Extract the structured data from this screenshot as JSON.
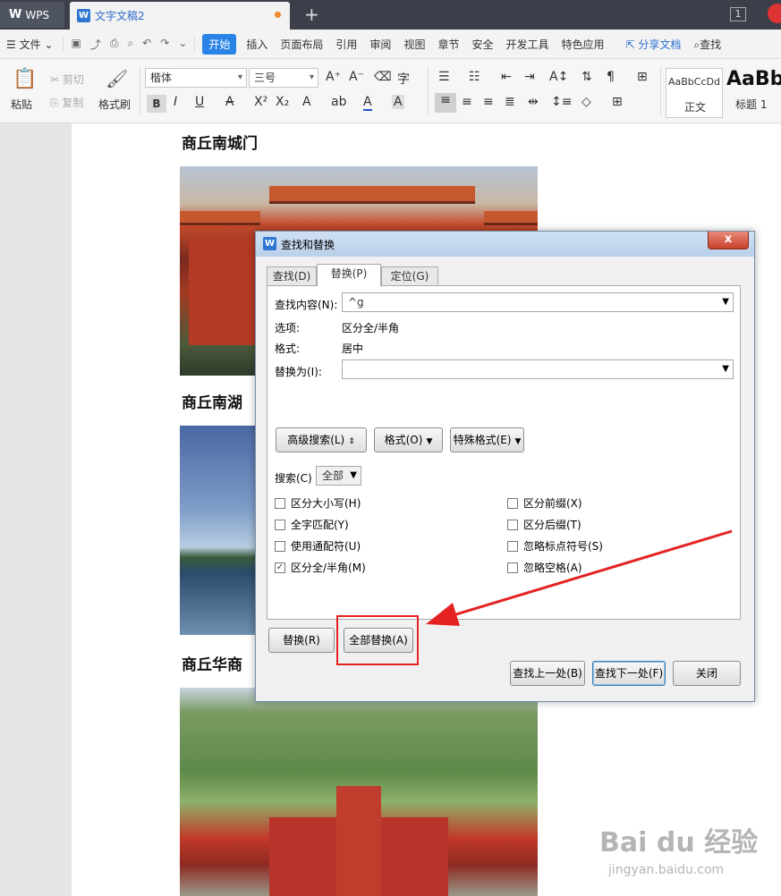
{
  "titlebar": {
    "app_tab": "WPS",
    "doc_tab": "文字文稿2",
    "new_tab": "+",
    "window_count": "1"
  },
  "menubar": {
    "file": "文件",
    "tabs": [
      "开始",
      "插入",
      "页面布局",
      "引用",
      "审阅",
      "视图",
      "章节",
      "安全",
      "开发工具",
      "特色应用"
    ],
    "active_tab": "开始",
    "share": "分享文档",
    "search": "查找"
  },
  "ribbon": {
    "paste": "粘贴",
    "cut": "剪切",
    "copy": "复制",
    "format_painter": "格式刷",
    "font_name": "楷体",
    "font_size": "三号",
    "style_normal_preview": "AaBbCcDd",
    "style_normal": "正文",
    "style_h1_preview": "AaBb",
    "style_h1": "标题 1"
  },
  "document": {
    "heading1": "商丘南城门",
    "heading2": "商丘南湖",
    "heading3": "商丘华商"
  },
  "dialog": {
    "title": "查找和替换",
    "close": "x",
    "tabs": [
      "查找(D)",
      "替换(P)",
      "定位(G)"
    ],
    "active_tab": "替换(P)",
    "find_label": "查找内容(N):",
    "find_value": "^g",
    "options_label": "选项:",
    "options_value": "区分全/半角",
    "format_label": "格式:",
    "format_value": "居中",
    "replace_label": "替换为(I):",
    "replace_value": "",
    "advanced_btn": "高级搜索(L)",
    "format_btn": "格式(O)",
    "special_btn": "特殊格式(E)",
    "search_label": "搜索(C)",
    "search_value": "全部",
    "checkboxes": [
      {
        "label": "区分大小写(H)",
        "checked": false
      },
      {
        "label": "全字匹配(Y)",
        "checked": false
      },
      {
        "label": "使用通配符(U)",
        "checked": false
      },
      {
        "label": "区分全/半角(M)",
        "checked": true
      },
      {
        "label": "区分前缀(X)",
        "checked": false
      },
      {
        "label": "区分后缀(T)",
        "checked": false
      },
      {
        "label": "忽略标点符号(S)",
        "checked": false
      },
      {
        "label": "忽略空格(A)",
        "checked": false
      }
    ],
    "replace_btn": "替换(R)",
    "replace_all_btn": "全部替换(A)",
    "find_prev_btn": "查找上一处(B)",
    "find_next_btn": "查找下一处(F)",
    "close_btn": "关闭"
  },
  "watermark": {
    "brand": "Bai du 经验",
    "url": "jingyan.baidu.com"
  },
  "colors": {
    "accent": "#2a84e8",
    "annotation": "#e52222"
  }
}
